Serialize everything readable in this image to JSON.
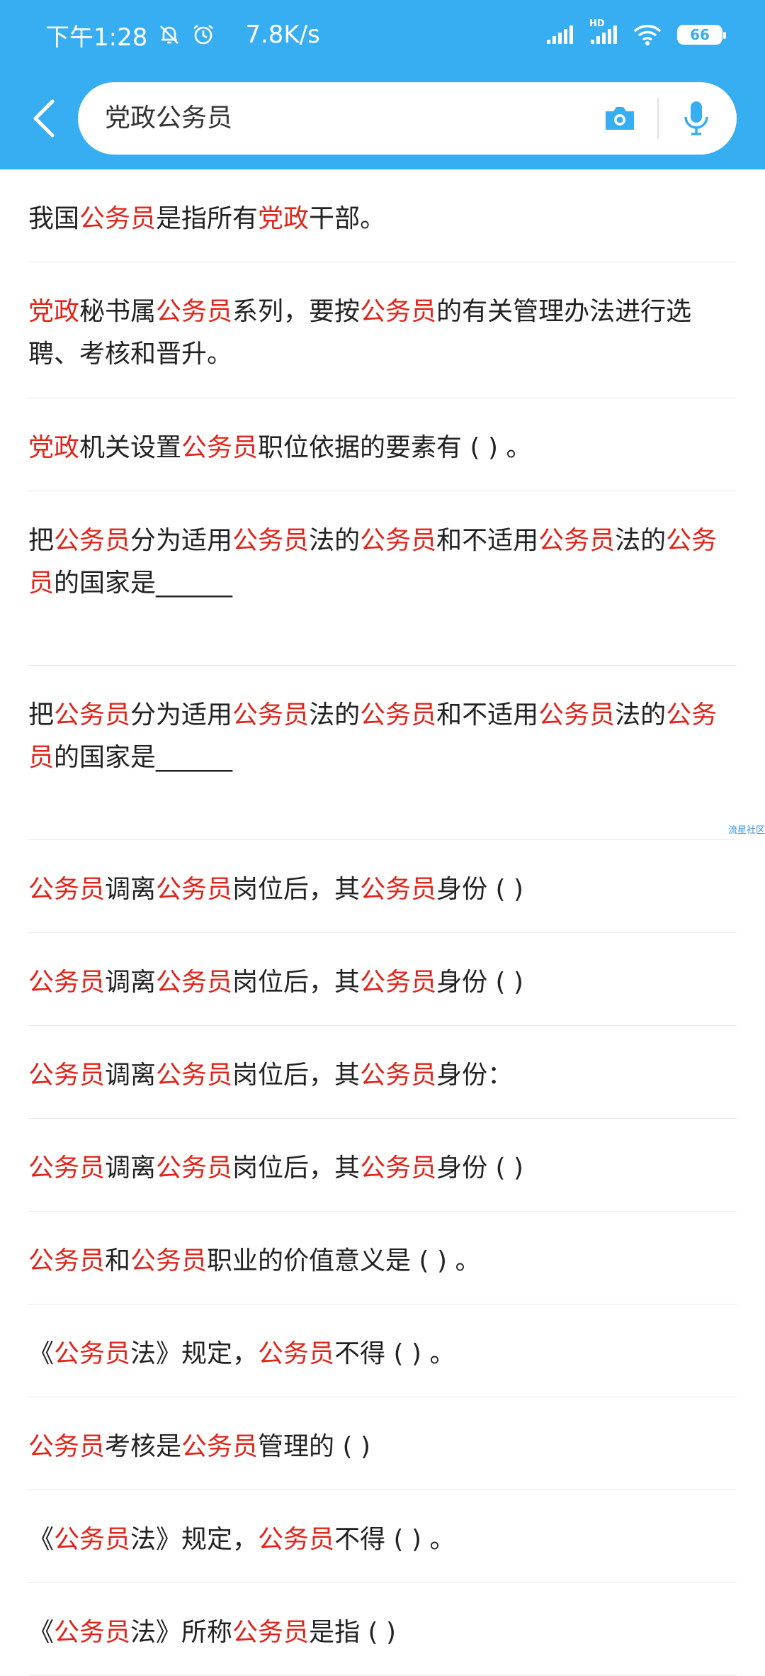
{
  "status_bar": {
    "time": "下午1:28",
    "net_speed": "7.8K/s",
    "hd_label": "HD",
    "battery": "66",
    "icons": [
      "mute-bell-icon",
      "alarm-clock-icon",
      "signal-icon",
      "signal-hd-icon",
      "wifi-icon",
      "battery-icon"
    ]
  },
  "search": {
    "query": "党政公务员",
    "back_icon": "back-arrow-icon",
    "camera_icon": "camera-icon",
    "mic_icon": "microphone-icon"
  },
  "colors": {
    "header": "#38aef2",
    "highlight": "#e0251b",
    "text": "#222222"
  },
  "watermark": "流星社区",
  "results": [
    {
      "segments": [
        [
          "我国",
          0
        ],
        [
          "公务员",
          1
        ],
        [
          "是指所有",
          0
        ],
        [
          "党政",
          1
        ],
        [
          "干部。",
          0
        ]
      ],
      "lines": 1
    },
    {
      "segments": [
        [
          "党政",
          1
        ],
        [
          "秘书属",
          0
        ],
        [
          "公务员",
          1
        ],
        [
          "系列，要按",
          0
        ],
        [
          "公务员",
          1
        ],
        [
          "的有关管理办法进行选聘、考核和晋升。",
          0
        ]
      ],
      "lines": 2
    },
    {
      "segments": [
        [
          "党政",
          1
        ],
        [
          "机关设置",
          0
        ],
        [
          "公务员",
          1
        ],
        [
          "职位依据的要素有 ( ) 。",
          0
        ]
      ],
      "lines": 1
    },
    {
      "segments": [
        [
          "把",
          0
        ],
        [
          "公务员",
          1
        ],
        [
          "分为适用",
          0
        ],
        [
          "公务员",
          1
        ],
        [
          "法的",
          0
        ],
        [
          "公务员",
          1
        ],
        [
          "和不适用",
          0
        ],
        [
          "公务员",
          1
        ],
        [
          "法的",
          0
        ],
        [
          "公务员",
          1
        ],
        [
          "的国家是______",
          0
        ]
      ],
      "lines": 3
    },
    {
      "segments": [
        [
          "把",
          0
        ],
        [
          "公务员",
          1
        ],
        [
          "分为适用",
          0
        ],
        [
          "公务员",
          1
        ],
        [
          "法的",
          0
        ],
        [
          "公务员",
          1
        ],
        [
          "和不适用",
          0
        ],
        [
          "公务员",
          1
        ],
        [
          "法的",
          0
        ],
        [
          "公务员",
          1
        ],
        [
          "的国家是______",
          0
        ]
      ],
      "lines": 3
    },
    {
      "segments": [
        [
          "公务员",
          1
        ],
        [
          "调离",
          0
        ],
        [
          "公务员",
          1
        ],
        [
          "岗位后，其",
          0
        ],
        [
          "公务员",
          1
        ],
        [
          "身份 ( )",
          0
        ]
      ],
      "lines": 1
    },
    {
      "segments": [
        [
          "公务员",
          1
        ],
        [
          "调离",
          0
        ],
        [
          "公务员",
          1
        ],
        [
          "岗位后，其",
          0
        ],
        [
          "公务员",
          1
        ],
        [
          "身份 ( )",
          0
        ]
      ],
      "lines": 1
    },
    {
      "segments": [
        [
          "公务员",
          1
        ],
        [
          "调离",
          0
        ],
        [
          "公务员",
          1
        ],
        [
          "岗位后，其",
          0
        ],
        [
          "公务员",
          1
        ],
        [
          "身份：",
          0
        ]
      ],
      "lines": 1
    },
    {
      "segments": [
        [
          "公务员",
          1
        ],
        [
          "调离",
          0
        ],
        [
          "公务员",
          1
        ],
        [
          "岗位后，其",
          0
        ],
        [
          "公务员",
          1
        ],
        [
          "身份 ( )",
          0
        ]
      ],
      "lines": 1
    },
    {
      "segments": [
        [
          "公务员",
          1
        ],
        [
          "和",
          0
        ],
        [
          "公务员",
          1
        ],
        [
          "职业的价值意义是 ( ) 。",
          0
        ]
      ],
      "lines": 1
    },
    {
      "segments": [
        [
          "《",
          0
        ],
        [
          "公务员",
          1
        ],
        [
          "法》规定，",
          0
        ],
        [
          "公务员",
          1
        ],
        [
          "不得 ( ) 。",
          0
        ]
      ],
      "lines": 1
    },
    {
      "segments": [
        [
          "公务员",
          1
        ],
        [
          "考核是",
          0
        ],
        [
          "公务员",
          1
        ],
        [
          "管理的 ( )",
          0
        ]
      ],
      "lines": 1
    },
    {
      "segments": [
        [
          "《",
          0
        ],
        [
          "公务员",
          1
        ],
        [
          "法》规定，",
          0
        ],
        [
          "公务员",
          1
        ],
        [
          "不得 ( ) 。",
          0
        ]
      ],
      "lines": 1
    },
    {
      "segments": [
        [
          "《",
          0
        ],
        [
          "公务员",
          1
        ],
        [
          "法》所称",
          0
        ],
        [
          "公务员",
          1
        ],
        [
          "是指 ( )",
          0
        ]
      ],
      "lines": 1
    }
  ]
}
